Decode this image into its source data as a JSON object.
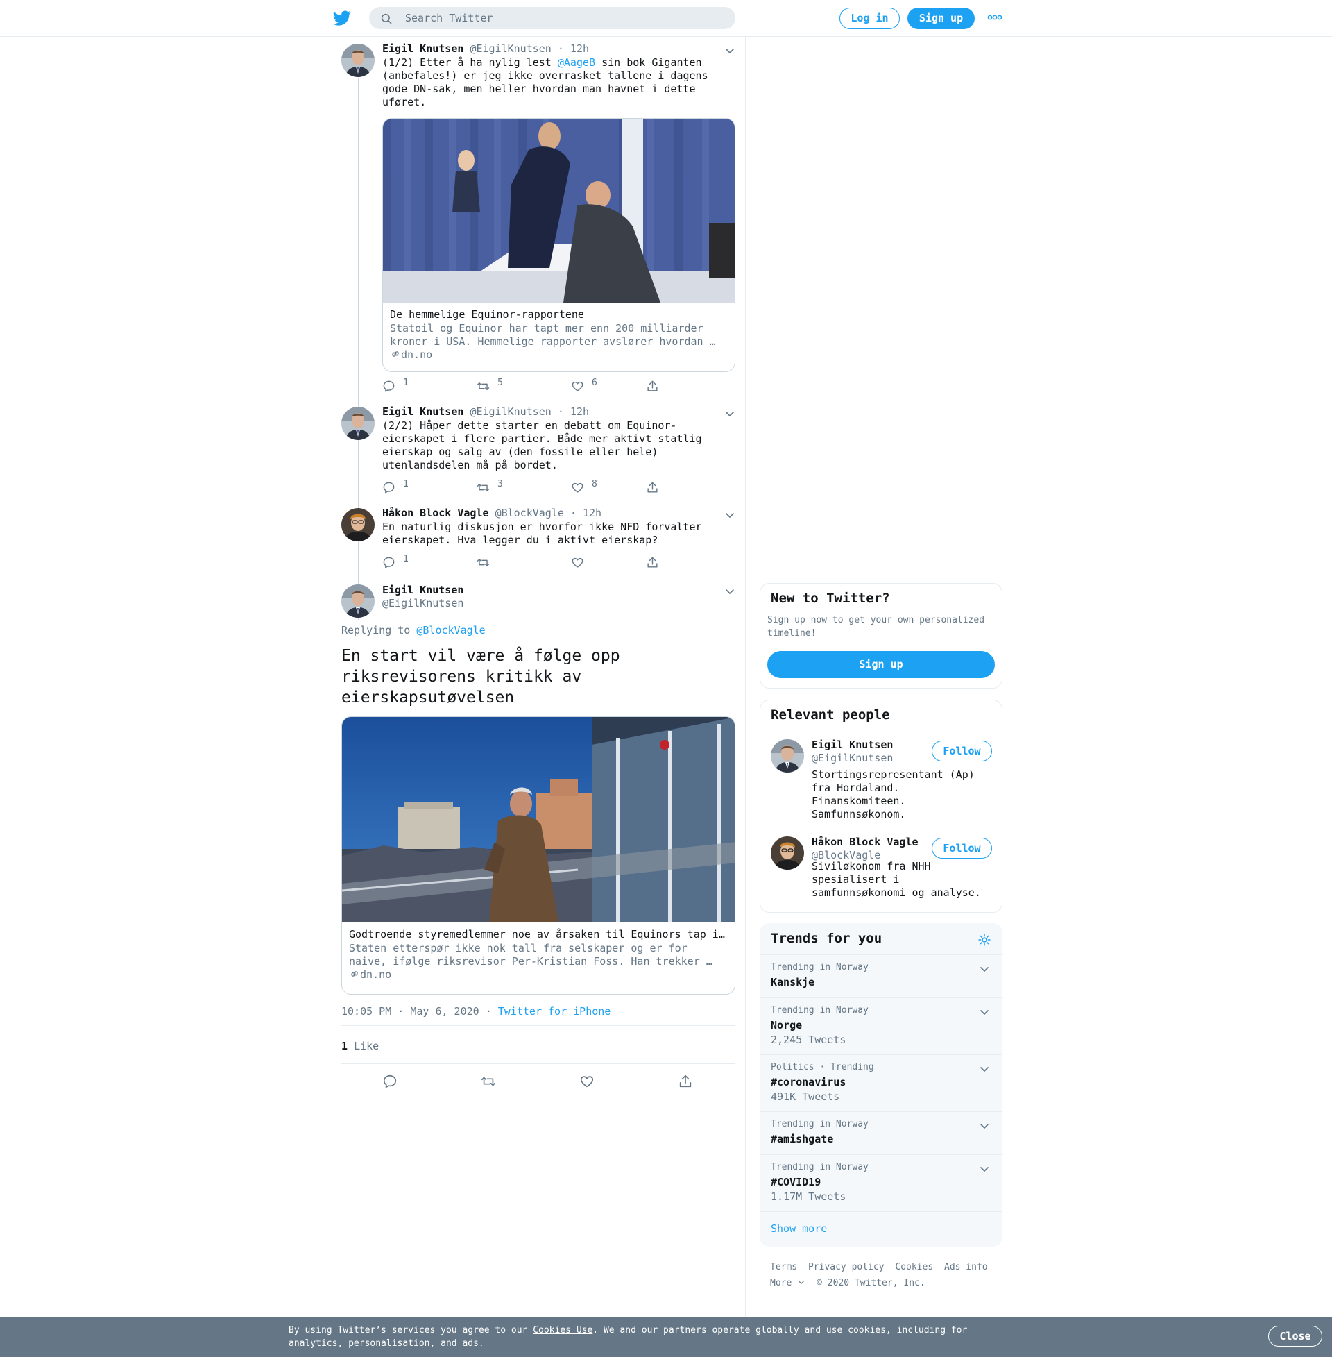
{
  "header": {
    "search_placeholder": "Search Twitter",
    "login_label": "Log in",
    "signup_label": "Sign up"
  },
  "thread": [
    {
      "name": "Eigil Knutsen",
      "handle": "@EigilKnutsen",
      "time": "· 12h",
      "text_parts": [
        "(1/2) Etter å ha nylig lest ",
        "@AageB",
        " sin bok Giganten (anbefales!) er jeg ikke overrasket tallene i dagens gode DN-sak, men heller hvordan man havnet i dette uføret."
      ],
      "card": {
        "title": "De hemmelige Equinor-rapportene",
        "description": "Statoil og Equinor har tapt mer enn 200 milliarder kroner i USA. Hemmelige rapporter avslører hvordan …",
        "domain": "dn.no"
      },
      "replies": "1",
      "retweets": "5",
      "likes": "6"
    },
    {
      "name": "Eigil Knutsen",
      "handle": "@EigilKnutsen",
      "time": "· 12h",
      "text": "(2/2) Håper dette starter en debatt om Equinor-eierskapet i flere partier. Både mer aktivt statlig eierskap og salg av (den fossile eller hele) utenlandsdelen må på bordet.",
      "replies": "1",
      "retweets": "3",
      "likes": "8"
    },
    {
      "name": "Håkon Block Vagle",
      "handle": "@BlockVagle",
      "time": "· 12h",
      "text": "En naturlig diskusjon er hvorfor ikke NFD forvalter eierskapet. Hva legger du i aktivt eierskap?",
      "replies": "1",
      "retweets": "",
      "likes": ""
    }
  ],
  "focus": {
    "name": "Eigil Knutsen",
    "handle": "@EigilKnutsen",
    "replying_label": "Replying to ",
    "replying_to": "@BlockVagle",
    "text": "En start vil være å følge opp riksrevisorens kritikk av eierskapsutøvelsen",
    "card": {
      "title": "Godtroende styremedlemmer noe av årsaken til Equinors tap i USA",
      "description": "Staten etterspør ikke nok tall fra selskaper og er for naive, ifølge riksrevisor Per-Kristian Foss. Han trekker …",
      "domain": "dn.no"
    },
    "timestamp": "10:05 PM · May 6, 2020 · ",
    "source": "Twitter for iPhone",
    "like_count": "1",
    "like_label": "Like"
  },
  "new_to_twitter": {
    "title": "New to Twitter?",
    "text": "Sign up now to get your own personalized timeline!",
    "button": "Sign up"
  },
  "relevant_people": {
    "title": "Relevant people",
    "follow_label": "Follow",
    "people": [
      {
        "name": "Eigil Knutsen",
        "handle": "@EigilKnutsen",
        "bio": "Stortingsrepresentant (Ap) fra Hordaland. Finanskomiteen. Samfunnsøkonom."
      },
      {
        "name": "Håkon Block Vagle",
        "handle": "@BlockVagle",
        "bio": "Siviløkonom fra NHH spesialisert i samfunnsøkonomi og analyse."
      }
    ]
  },
  "trends": {
    "title": "Trends for you",
    "items": [
      {
        "meta": "Trending in Norway",
        "name": "Kanskje",
        "count": ""
      },
      {
        "meta": "Trending in Norway",
        "name": "Norge",
        "count": "2,245 Tweets"
      },
      {
        "meta": "Politics · Trending",
        "name": "#coronavirus",
        "count": "491K Tweets"
      },
      {
        "meta": "Trending in Norway",
        "name": "#amishgate",
        "count": ""
      },
      {
        "meta": "Trending in Norway",
        "name": "#COVID19",
        "count": "1.17M Tweets"
      }
    ],
    "show_more": "Show more"
  },
  "footer": {
    "links": [
      "Terms",
      "Privacy policy",
      "Cookies",
      "Ads info"
    ],
    "more": "More",
    "copyright": "© 2020 Twitter, Inc."
  },
  "cookie_bar": {
    "text_before": "By using Twitter’s services you agree to our ",
    "link": "Cookies Use",
    "text_after": ". We and our partners operate globally and use cookies, including for analytics, personalisation, and ads.",
    "close": "Close"
  },
  "colors": {
    "accent": "#1da1f2",
    "secondary_text": "#657786",
    "border": "#e6ecf0",
    "cookie_bg": "#657786"
  }
}
